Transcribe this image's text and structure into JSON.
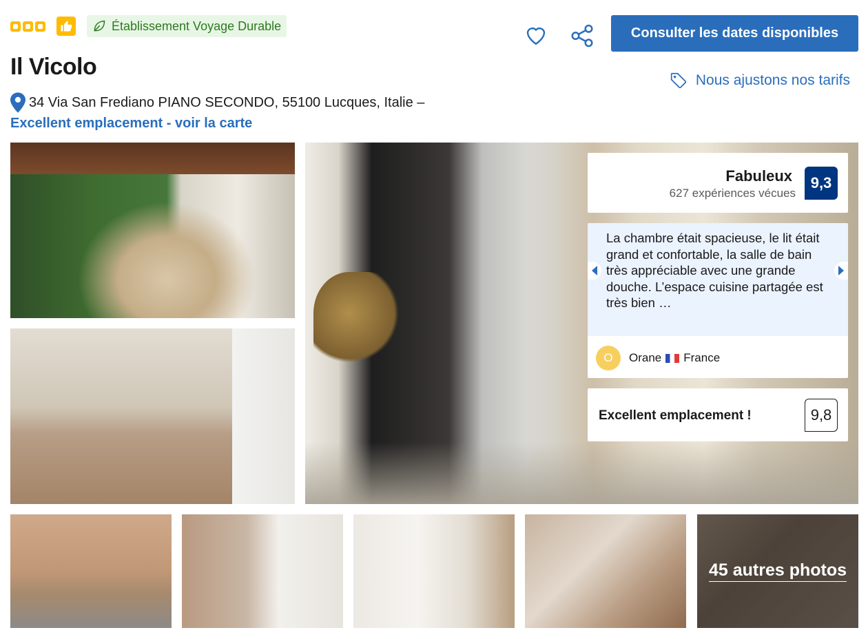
{
  "header": {
    "stars_count": 3,
    "badge_sustainable": "Établissement Voyage Durable",
    "title": "Il Vicolo",
    "address": "34 Via San Frediano PIANO SECONDO, 55100 Lucques, Italie –",
    "map_link": "Excellent emplacement - voir la carte",
    "cta_label": "Consulter les dates disponibles",
    "price_match": "Nous ajustons nos tarifs"
  },
  "icons": {
    "stars": "star-squares-icon",
    "thumb": "thumbs-up-icon",
    "leaf": "leaf-icon",
    "heart": "heart-icon",
    "share": "share-icon",
    "pin": "map-pin-icon",
    "tag": "price-tag-icon"
  },
  "colors": {
    "brand_blue": "#2a6ebb",
    "score_navy": "#003580",
    "genius_yellow": "#febb02",
    "sustain_green": "#2d7a20"
  },
  "rating": {
    "label": "Fabuleux",
    "reviews": "627 expériences vécues",
    "score": "9,3"
  },
  "review": {
    "text": "La chambre était spacieuse, le lit était grand et confortable, la salle de bain très appréciable avec une grande douche. L’espace cuisine partagée est très bien …",
    "avatar_initial": "O",
    "name": "Orane",
    "country": "France"
  },
  "location": {
    "label": "Excellent emplacement !",
    "score": "9,8"
  },
  "gallery": {
    "more_photos": "45 autres photos"
  }
}
